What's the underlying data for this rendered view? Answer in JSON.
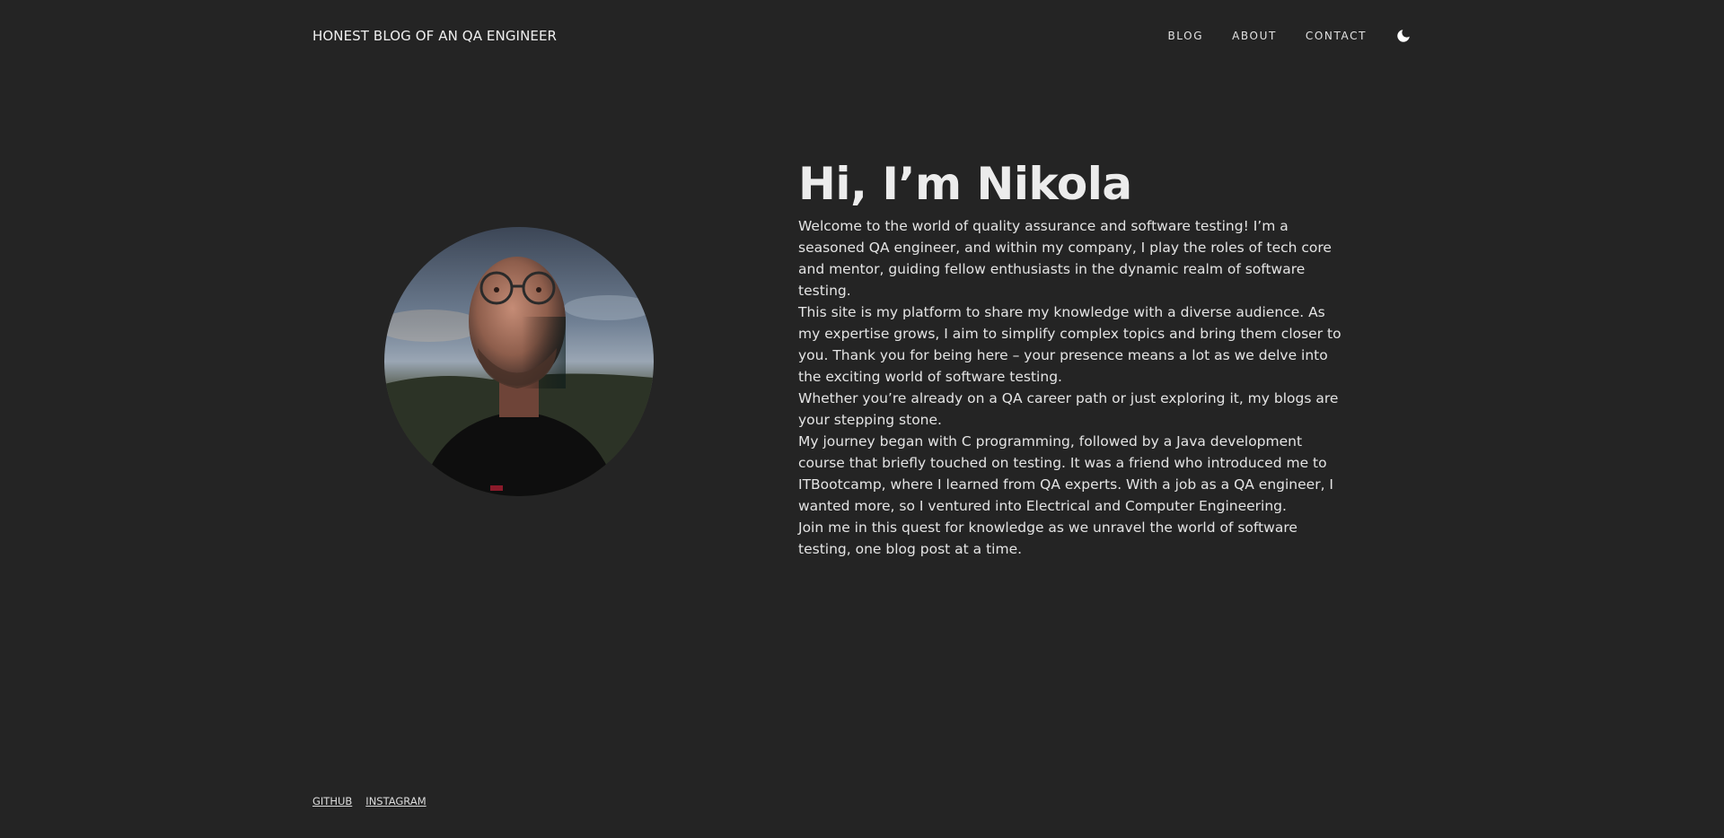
{
  "header": {
    "site_title": "HONEST BLOG OF AN QA ENGINEER",
    "nav": [
      {
        "label": "BLOG"
      },
      {
        "label": "ABOUT"
      },
      {
        "label": "CONTACT"
      }
    ],
    "theme_toggle_icon": "moon-icon"
  },
  "hero": {
    "avatar_icon": "profile-photo",
    "heading": "Hi, I’m Nikola",
    "paragraphs": [
      "Welcome to the world of quality assurance and software testing! I’m a seasoned QA engineer, and within my company, I play the roles of tech core and mentor, guiding fellow enthusiasts in the dynamic realm of software testing.",
      "This site is my platform to share my knowledge with a diverse audience. As my expertise grows, I aim to simplify complex topics and bring them closer to you. Thank you for being here – your presence means a lot as we delve into the exciting world of software testing.",
      "Whether you’re already on a QA career path or just exploring it, my blogs are your stepping stone.",
      "My journey began with C programming, followed by a Java development course that briefly touched on testing. It was a friend who introduced me to ITBootcamp, where I learned from QA experts. With a job as a QA engineer, I wanted more, so I ventured into Electrical and Computer Engineering.",
      "Join me in this quest for knowledge as we unravel the world of software testing, one blog post at a time."
    ]
  },
  "footer": {
    "links": [
      {
        "label": "GITHUB"
      },
      {
        "label": "INSTAGRAM"
      }
    ]
  },
  "colors": {
    "background": "#242424",
    "text": "#e8e8e8"
  }
}
